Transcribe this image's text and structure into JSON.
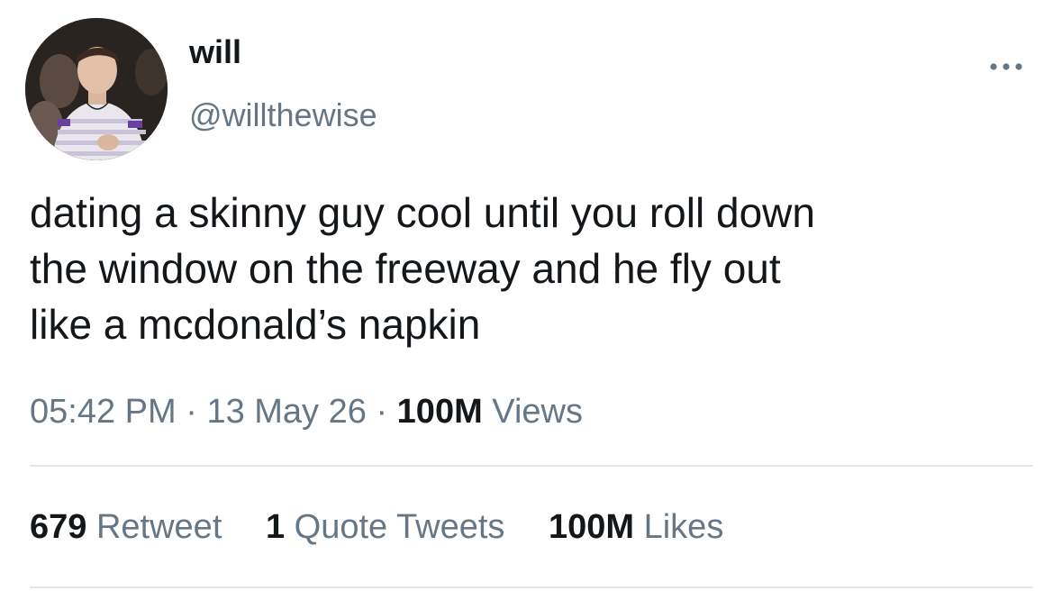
{
  "author": {
    "display_name": "will",
    "handle": "@willthewise"
  },
  "tweet": {
    "text_lines": [
      "dating a skinny guy cool until you roll down",
      "the window on the freeway and he fly out",
      "like a mcdonald’s napkin"
    ],
    "time": "05:42 PM",
    "date": "13 May 26",
    "separator": "·",
    "views_count": "100M",
    "views_label": "Views"
  },
  "stats": {
    "retweets_count": "679",
    "retweets_label": "Retweet",
    "quotes_count": "1",
    "quotes_label": "Quote Tweets",
    "likes_count": "100M",
    "likes_label": "Likes"
  },
  "icons": {
    "more": "more-horizontal-icon"
  },
  "colors": {
    "text_primary": "#14171a",
    "text_secondary": "#657786",
    "divider": "#e1e8ed",
    "background": "#ffffff"
  }
}
